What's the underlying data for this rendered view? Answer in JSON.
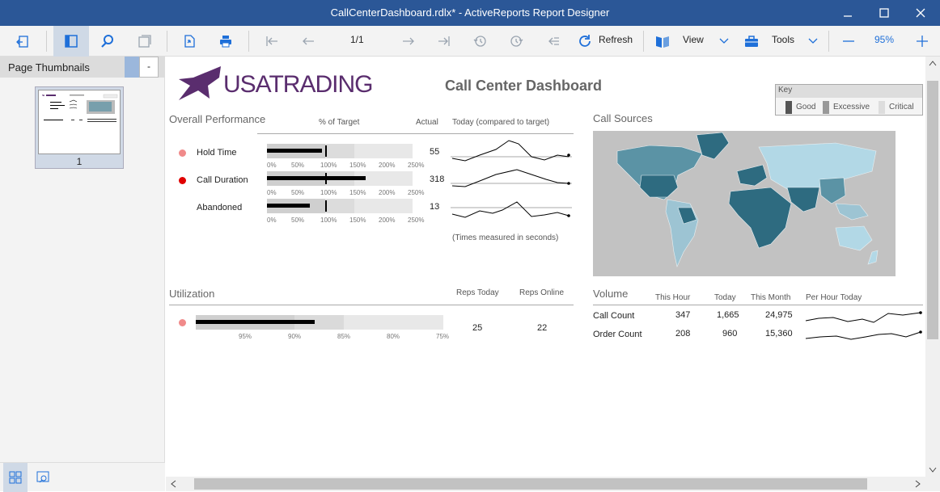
{
  "window": {
    "title": "CallCenterDashboard.rdlx* - ActiveReports Report Designer"
  },
  "toolbar": {
    "page_indicator": "1/1",
    "refresh_label": "Refresh",
    "view_label": "View",
    "tools_label": "Tools",
    "zoom": "95%"
  },
  "panel": {
    "title": "Page Thumbnails",
    "collapse": "-",
    "thumb_number": "1"
  },
  "report": {
    "logo_text": "USATRADING",
    "title": "Call Center Dashboard",
    "key": {
      "title": "Key",
      "good": "Good",
      "excessive": "Excessive",
      "critical": "Critical"
    },
    "overall": {
      "title": "Overall Performance",
      "col_target": "% of Target",
      "col_actual": "Actual",
      "col_today": "Today (compared to target)",
      "note": "(Times measured in seconds)",
      "ticks": [
        "0%",
        "50%",
        "100%",
        "150%",
        "200%",
        "250%"
      ],
      "rows": [
        {
          "label": "Hold Time",
          "actual": "55",
          "status_color": "#f08a8a",
          "pct": 0.95
        },
        {
          "label": "Call Duration",
          "actual": "318",
          "status_color": "#e00000",
          "pct": 1.7
        },
        {
          "label": "Abandoned",
          "actual": "13",
          "status_color": "",
          "pct": 0.73
        }
      ]
    },
    "sources": {
      "title": "Call Sources"
    },
    "utilization": {
      "title": "Utilization",
      "col_today": "Reps Today",
      "col_online": "Reps Online",
      "ticks": [
        "95%",
        "90%",
        "85%",
        "80%",
        "75%"
      ],
      "reps_today": "25",
      "reps_online": "22",
      "status_color": "#f08a8a",
      "value_pct": 0.48
    },
    "volume": {
      "title": "Volume",
      "cols": [
        "This Hour",
        "Today",
        "This Month",
        "Per Hour Today"
      ],
      "rows": [
        {
          "label": "Call Count",
          "hour": "347",
          "today": "1,665",
          "month": "24,975"
        },
        {
          "label": "Order Count",
          "hour": "208",
          "today": "960",
          "month": "15,360"
        }
      ]
    }
  },
  "colors": {
    "titlebar": "#2b5797",
    "accent": "#1e6fd9",
    "logo": "#5a2d6e"
  }
}
